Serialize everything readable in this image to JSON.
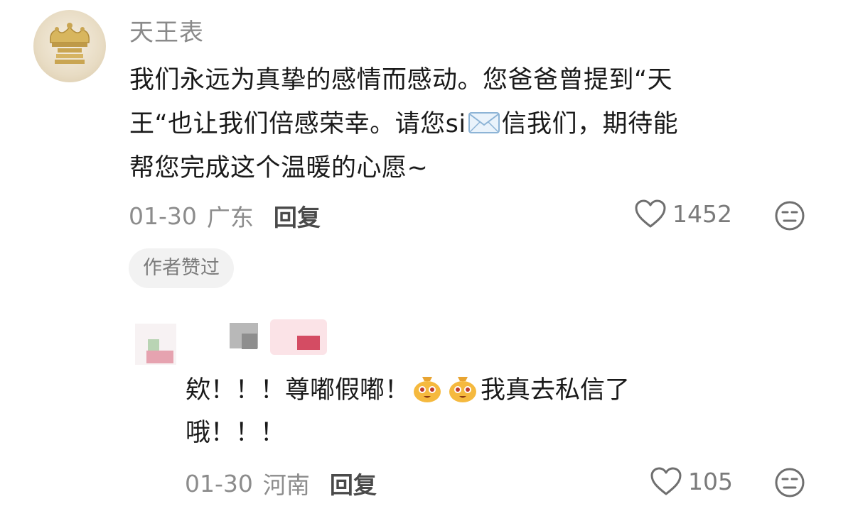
{
  "comment": {
    "author": "天王表",
    "text_lines": [
      "我们永远为真挚的感情而感动。您爸爸曾提到“天",
      "王“也让我们倍感荣幸。请您si",
      "信我们，期待能",
      "帮您完成这个温暖的心愿~"
    ],
    "date": "01-30",
    "location": "广东",
    "reply_label": "回复",
    "likes": "1452",
    "author_liked_badge": "作者赞过"
  },
  "reply": {
    "text_line1_a": "欸！！！尊嘟假嘟！",
    "text_line1_b": "我真去私信了",
    "text_line2": "哦！！！",
    "date": "01-30",
    "location": "河南",
    "reply_label": "回复",
    "likes": "105"
  },
  "icons": {
    "like": "heart-outline-icon",
    "dislike": "neutral-face-icon",
    "mail": "envelope-emoji",
    "reply_emoji": "pleading-money-bag-emoji"
  },
  "colors": {
    "meta_gray": "#8c8c8c",
    "badge_bg": "#f2f2f2",
    "text": "#1a1a1a"
  }
}
